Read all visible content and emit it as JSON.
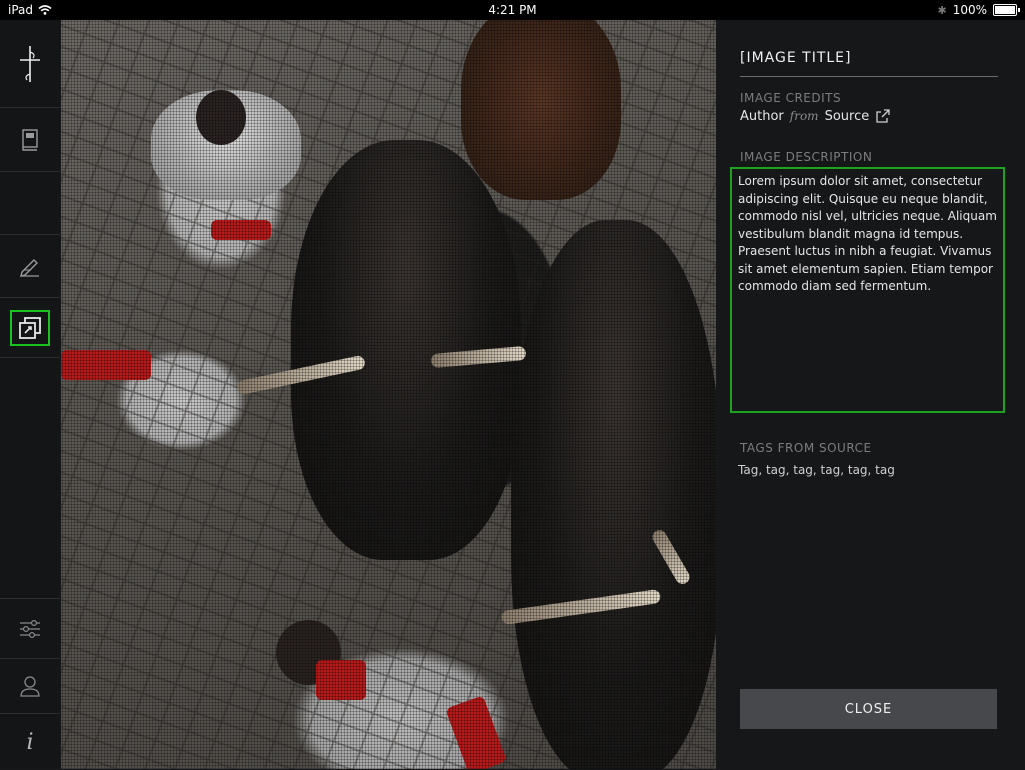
{
  "status_bar": {
    "device": "iPad",
    "time": "4:21 PM",
    "battery": "100%"
  },
  "left_nav": {
    "items": [
      {
        "name": "logo",
        "icon": "dagger-logo-icon"
      },
      {
        "name": "book",
        "icon": "book-icon"
      },
      {
        "name": "blank",
        "icon": ""
      },
      {
        "name": "edit",
        "icon": "pencil-icon"
      },
      {
        "name": "gallery",
        "icon": "gallery-external-icon",
        "selected": true
      },
      {
        "name": "settings",
        "icon": "sliders-icon"
      },
      {
        "name": "profile",
        "icon": "user-icon"
      },
      {
        "name": "info",
        "icon": "info-icon"
      }
    ],
    "accent_color": "#19c21f"
  },
  "panel": {
    "title": "[IMAGE TITLE]",
    "credits_label": "IMAGE CREDITS",
    "credits_author": "Author",
    "credits_from": "from",
    "credits_source": "Source",
    "description_label": "IMAGE DESCRIPTION",
    "description_text": "Lorem ipsum dolor sit amet, consectetur adipiscing elit. Quisque eu neque blandit, commodo nisl vel, ultricies neque. Aliquam vestibulum blandit magna id tempus. Praesent luctus in nibh a feugiat. Vivamus sit amet elementum sapien. Etiam tempor commodo diam sed fermentum.",
    "tags_label": "TAGS FROM SOURCE",
    "tags_text": "Tag, tag, tag, tag, tag, tag",
    "close_label": "CLOSE",
    "focus_border_color": "#1ea321"
  }
}
